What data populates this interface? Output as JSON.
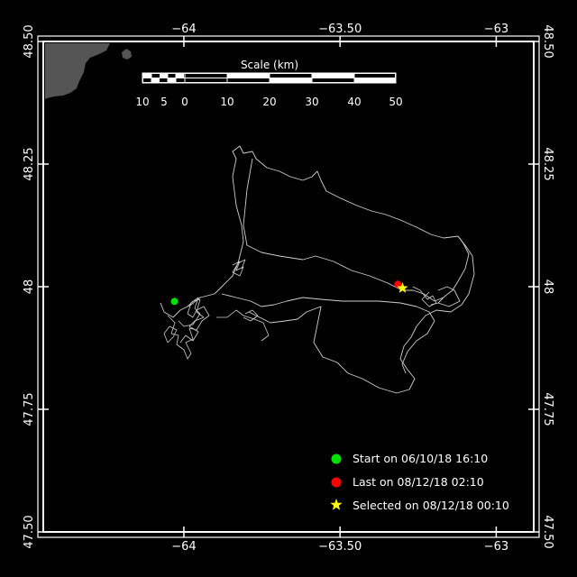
{
  "colors": {
    "background": "#000000",
    "frame": "#ffffff",
    "land": "#555555",
    "track": "#cfcfcf",
    "start": "#00e000",
    "last": "#ff0000",
    "selected": "#ffff00"
  },
  "map": {
    "lon_range": [
      -64.45,
      -62.88
    ],
    "lat_range": [
      47.5,
      48.5
    ],
    "x_ticks": [
      {
        "value": -64,
        "label": "−64"
      },
      {
        "value": -63.5,
        "label": "−63.50"
      },
      {
        "value": -63,
        "label": "−63"
      }
    ],
    "y_ticks": [
      {
        "value": 48.5,
        "label": "48.50"
      },
      {
        "value": 48.25,
        "label": "48.25"
      },
      {
        "value": 48.0,
        "label": "48"
      },
      {
        "value": 47.75,
        "label": "47.75"
      },
      {
        "value": 47.5,
        "label": "47.50"
      }
    ]
  },
  "scale_bar": {
    "title": "Scale (km)",
    "labels": [
      "10",
      "5",
      "0",
      "10",
      "20",
      "30",
      "40",
      "50"
    ]
  },
  "markers": {
    "start": {
      "lon": -64.03,
      "lat": 47.97
    },
    "last": {
      "lon": -63.315,
      "lat": 48.005
    },
    "selected": {
      "lon": -63.3,
      "lat": 47.997
    }
  },
  "legend": {
    "start": "Start on 06/10/18 16:10",
    "last": "Last on 08/12/18 02:10",
    "selected": "Selected on 08/12/18 00:10"
  }
}
